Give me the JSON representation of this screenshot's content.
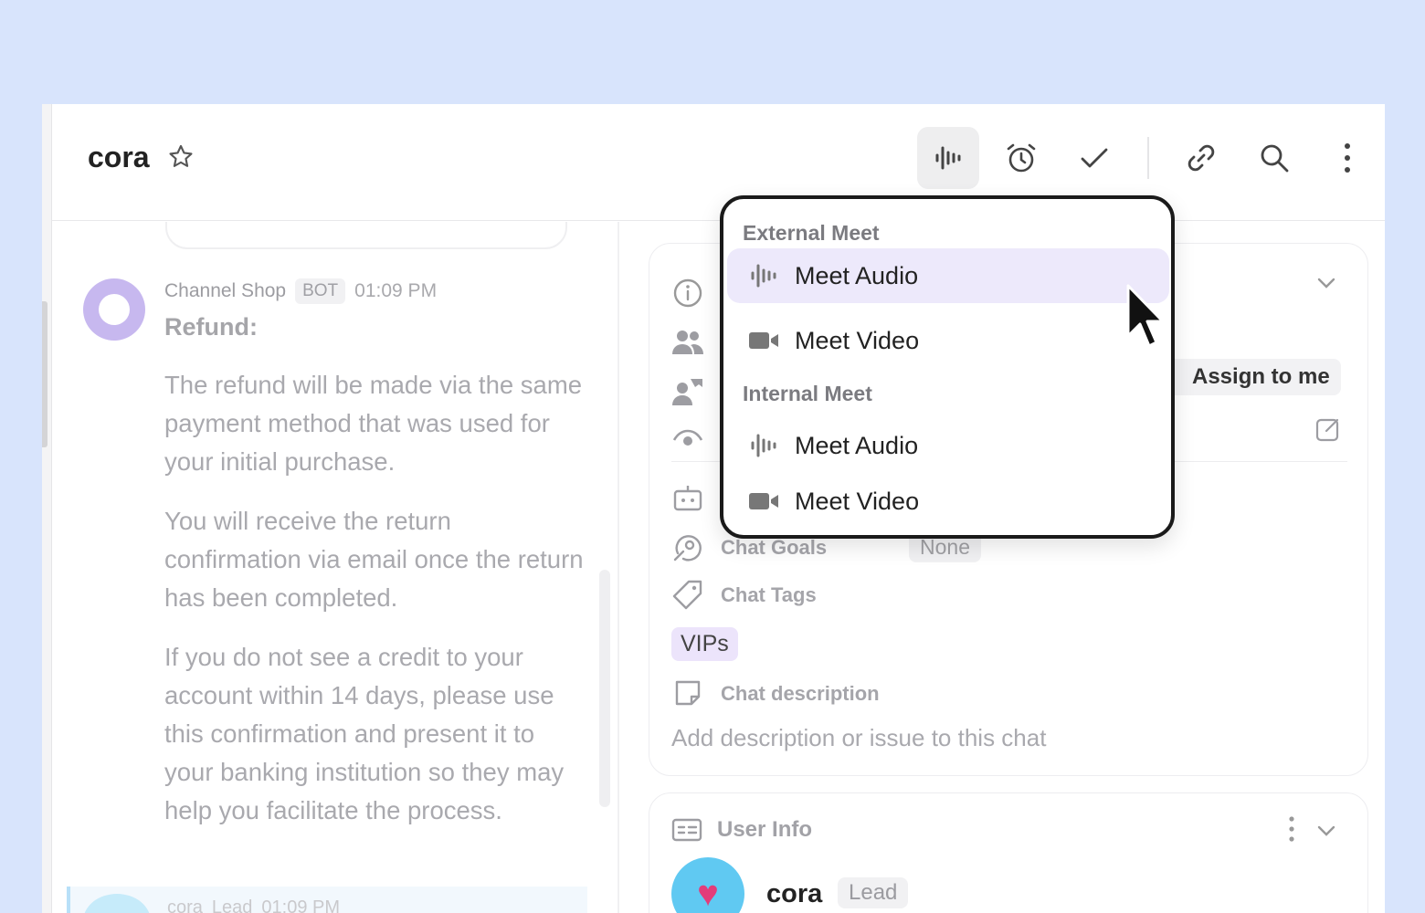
{
  "header": {
    "title": "cora"
  },
  "chat": {
    "sender": "Channel Shop",
    "sender_badge": "BOT",
    "time": "01:09 PM",
    "message_title": "Refund:",
    "paragraphs": [
      "The refund will be made via the same payment method that was used for your initial purchase.",
      "You will receive the return confirmation via email once the return has been completed.",
      "If you do not see a credit to your account within 14 days, please use this confirmation and present it to your banking institution so they may help you facilitate the process."
    ],
    "next_sender": "cora",
    "next_badge": "Lead",
    "next_time": "01:09 PM"
  },
  "info": {
    "assign_label": "Assign to me",
    "chat_goals_label": "Chat Goals",
    "chat_goals_value": "None",
    "chat_tags_label": "Chat Tags",
    "tag": "VIPs",
    "description_label": "Chat description",
    "description_placeholder": "Add description or issue to this chat"
  },
  "user_info": {
    "title": "User Info",
    "name": "cora",
    "badge": "Lead"
  },
  "dropdown": {
    "external_header": "External Meet",
    "internal_header": "Internal Meet",
    "external_audio": "Meet Audio",
    "external_video": "Meet Video",
    "internal_audio": "Meet Audio",
    "internal_video": "Meet Video"
  }
}
